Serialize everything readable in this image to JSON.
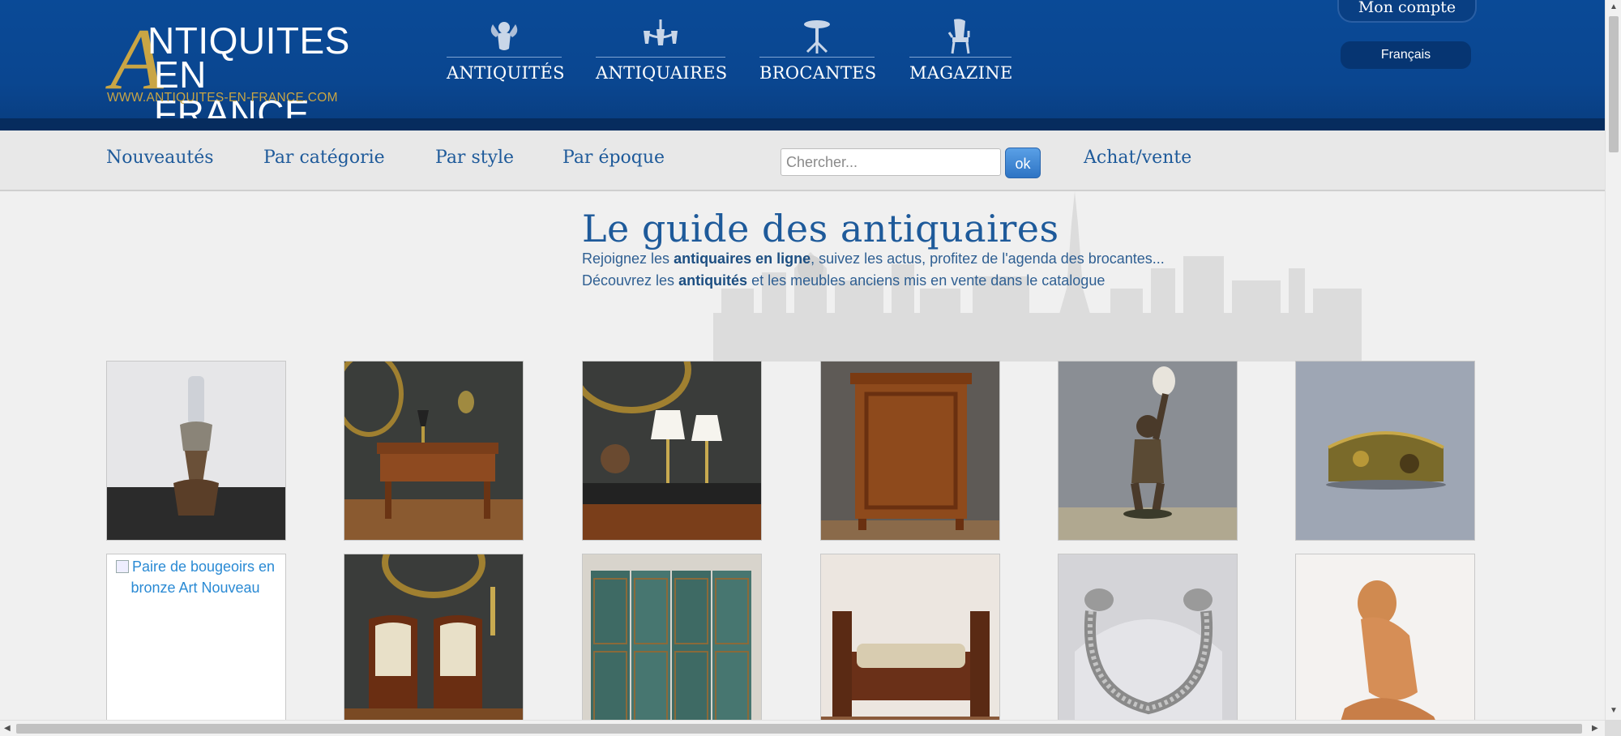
{
  "header": {
    "logo": {
      "big_letter": "A",
      "line1": "NTIQUITES",
      "line2": "EN FRANCE",
      "url": "WWW.ANTIQUITES-EN-FRANCE.COM"
    },
    "main_nav": [
      {
        "label": "ANTIQUITÉS",
        "icon": "cherub-icon"
      },
      {
        "label": "ANTIQUAIRES",
        "icon": "chandelier-icon"
      },
      {
        "label": "BROCANTES",
        "icon": "pedestal-table-icon"
      },
      {
        "label": "MAGAZINE",
        "icon": "armchair-icon"
      }
    ],
    "account_label": "Mon compte",
    "language_label": "Français"
  },
  "subnav": {
    "items": [
      "Nouveautés",
      "Par catégorie",
      "Par style",
      "Par époque"
    ],
    "search_placeholder": "Chercher...",
    "search_button": "ok",
    "buy_sell": "Achat/vente"
  },
  "hero": {
    "title": "Le guide des antiquaires",
    "line1_prefix": "Rejoignez les ",
    "line1_bold": "antiquaires en ligne",
    "line1_suffix": ", suivez les actus, profitez de l'agenda des brocantes...",
    "line2_prefix": "Découvrez les ",
    "line2_bold": "antiquités",
    "line2_suffix": " et les meubles anciens mis en vente dans le catalogue"
  },
  "products": {
    "row1": [
      {
        "image": "oil-lamp-image"
      },
      {
        "image": "writing-desk-image"
      },
      {
        "image": "desk-lamps-image"
      },
      {
        "image": "wooden-cabinet-image"
      },
      {
        "image": "bronze-statue-lamp-image"
      },
      {
        "image": "decorative-box-image"
      }
    ],
    "row2": [
      {
        "image": "broken-image",
        "alt": "Paire de bougeoirs en bronze Art Nouveau"
      },
      {
        "image": "pair-of-armchairs-image"
      },
      {
        "image": "folding-screen-image"
      },
      {
        "image": "daybed-image"
      },
      {
        "image": "silver-bracelet-image"
      },
      {
        "image": "terracotta-sculpture-image"
      }
    ]
  },
  "colors": {
    "header_blue": "#0a4a97",
    "link_blue": "#1e5a9a",
    "gold": "#c9a544"
  }
}
